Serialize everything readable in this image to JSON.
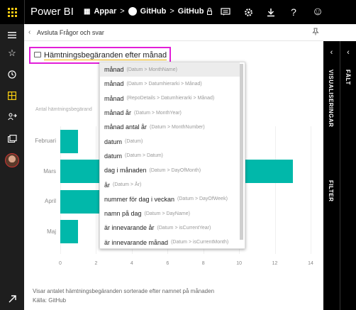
{
  "topbar": {
    "brand": "Power BI",
    "breadcrumb": [
      "Appar",
      "GitHub",
      "GitHub"
    ],
    "buttons": [
      "comment-icon",
      "gear-icon",
      "download-icon",
      "help-icon",
      "smiley-icon"
    ],
    "help_glyph": "?",
    "smiley_glyph": "☺"
  },
  "subheader": {
    "exit_label": "Avsluta Frågor och svar"
  },
  "qa": {
    "question": "Hämtningsbegäranden efter månad"
  },
  "dropdown": {
    "items": [
      {
        "label": "månad",
        "hint": "(Datum > MonthName)"
      },
      {
        "label": "månad",
        "hint": "(Datum > Datumhierarki > Månad)"
      },
      {
        "label": "månad",
        "hint": "(RepoDetails > Datumhierarki > Månad)"
      },
      {
        "label": "månad år",
        "hint": "(Datum > MonthYear)"
      },
      {
        "label": "månad  antal år",
        "hint": "(Datum > MonthNumber)"
      },
      {
        "label": "datum",
        "hint": "(Datum)"
      },
      {
        "label": "datum",
        "hint": "(Datum > Datum)"
      },
      {
        "label": "dag i månaden",
        "hint": "(Datum > DayOfMonth)"
      },
      {
        "label": "år",
        "hint": "(Datum > År)"
      },
      {
        "label": "nummer för dag i veckan",
        "hint": "(Datum > DayOfWeek)"
      },
      {
        "label": "namn på dag",
        "hint": "(Datum > DayName)"
      },
      {
        "label": "är innevarande år",
        "hint": "(Datum > isCurrentYear)"
      },
      {
        "label": "är innevarande månad",
        "hint": "(Datum > isCurrentMonth)"
      }
    ]
  },
  "chart_data": {
    "type": "bar",
    "orientation": "horizontal",
    "ylabel": "Antal hämtningsbegärand",
    "categories": [
      "Februari",
      "Mars",
      "April",
      "Maj"
    ],
    "values": [
      1,
      13,
      2.3,
      1
    ],
    "xlim": [
      0,
      14
    ],
    "xticks": [
      "0",
      "2",
      "4",
      "6",
      "8",
      "10",
      "12",
      "14"
    ],
    "color": "#01B8AA"
  },
  "footer": {
    "description": "Visar antalet hämtningsbegäranden sorterade efter namnet på månaden",
    "source": "Källa: GitHub"
  },
  "panes": {
    "visualizations": "VISUALISERINGAR",
    "filters": "FILTER",
    "fields": "FÄLT"
  },
  "colors": {
    "accent": "#F2C811",
    "highlight_border": "#e21ed8",
    "bar": "#01B8AA"
  }
}
